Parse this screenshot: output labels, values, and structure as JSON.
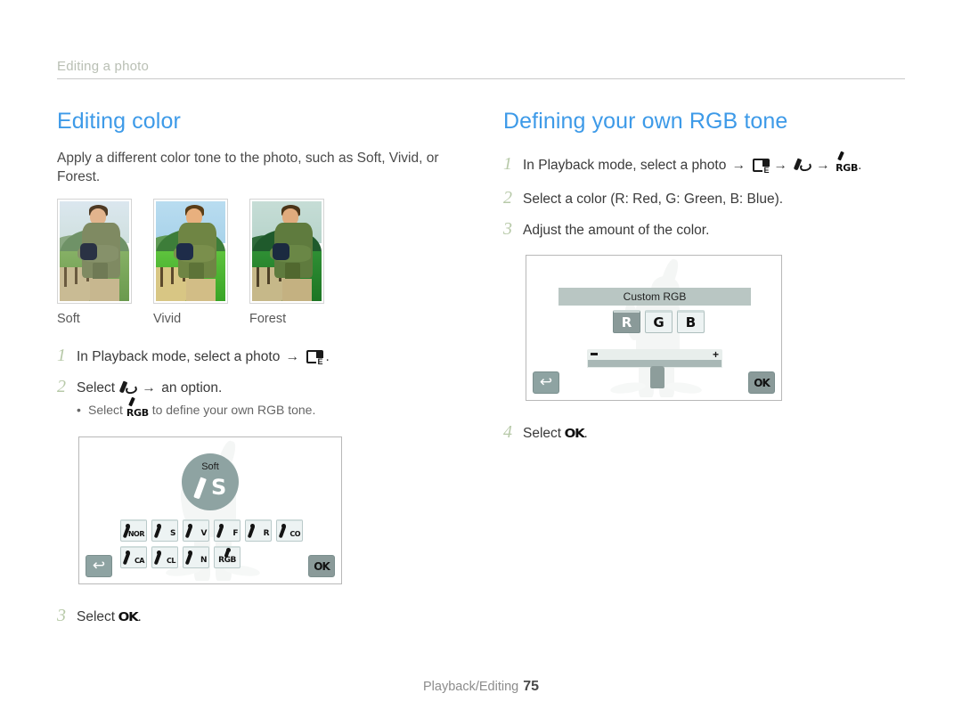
{
  "running_header": {
    "text": "Editing a photo"
  },
  "left_column": {
    "title": "Editing color",
    "lead": "Apply a different color tone to the photo, such as Soft, Vivid, or Forest.",
    "samples": [
      {
        "caption": "Soft"
      },
      {
        "caption": "Vivid"
      },
      {
        "caption": "Forest"
      }
    ],
    "steps": [
      {
        "num": "1",
        "text_before": "In Playback mode, select a photo",
        "icons": [
          "arrow",
          "edit-icon"
        ],
        "text_after": "."
      },
      {
        "num": "2",
        "text_before": "Select",
        "icons": [
          "brush-icon",
          "arrow"
        ],
        "text_after": "an option."
      },
      {
        "num": "3",
        "text_before": "Select",
        "icons": [
          "ok-icon"
        ],
        "text_after": "."
      }
    ],
    "substep": {
      "bullet": "•",
      "text_before": "Select",
      "text_after": "to define your own RGB tone."
    },
    "screen": {
      "badge_label": "Soft",
      "badge_letter": "S",
      "options_row1": [
        "NOR",
        "S",
        "V",
        "F",
        "R",
        "CO"
      ],
      "options_row2": [
        "CA",
        "CL",
        "N",
        "RGB"
      ],
      "back_label": "↩",
      "ok_label": "OK"
    }
  },
  "right_column": {
    "title": "Defining your own RGB tone",
    "steps": [
      {
        "num": "1",
        "text_before": "In Playback mode, select a photo",
        "text_after": "."
      },
      {
        "num": "2",
        "text": "Select a color (R: Red, G: Green, B: Blue)."
      },
      {
        "num": "3",
        "text": "Adjust the amount of the color."
      },
      {
        "num": "4",
        "text_before": "Select",
        "text_after": "."
      }
    ],
    "screen": {
      "title_label": "Custom RGB",
      "tabs": [
        {
          "label": "R",
          "selected": true
        },
        {
          "label": "G",
          "selected": false
        },
        {
          "label": "B",
          "selected": false
        }
      ],
      "slider_minus": "−",
      "slider_plus": "+",
      "back_label": "↩",
      "ok_label": "OK"
    }
  },
  "footer": {
    "section": "Playback/Editing",
    "page": "75"
  },
  "colors": {
    "accent_heading": "#3d9ae8",
    "step_number": "#b7c9a8",
    "running_header": "#b9bfb4",
    "screen_ui": "#8ea3a2",
    "button_face": "#edf3f3"
  }
}
